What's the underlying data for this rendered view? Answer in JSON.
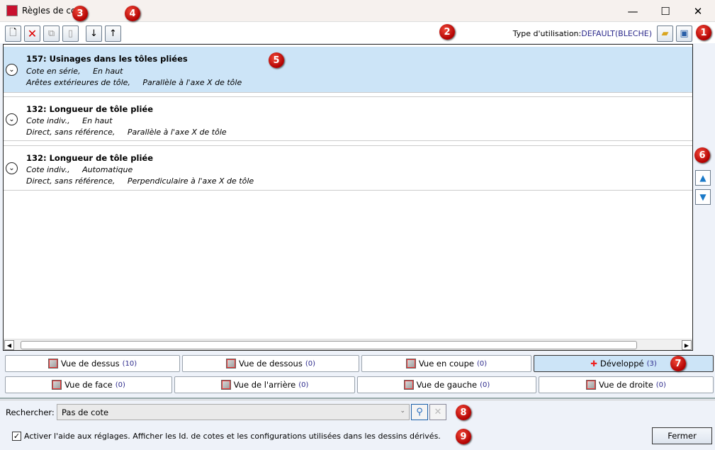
{
  "window": {
    "title": "Règles de cote",
    "minimize": "—",
    "maximize": "☐",
    "close": "✕"
  },
  "toolbar": {
    "type_label": "Type d'utilisation:",
    "type_value": "DEFAULT(BLECHE)"
  },
  "rules": [
    {
      "title": "157: Usinages dans les tôles pliées",
      "line1a": "Cote en série,",
      "line1b": "En haut",
      "line2a": "Arêtes extérieures de tôle,",
      "line2b": "Parallèle à l'axe X de tôle",
      "selected": true
    },
    {
      "title": "132: Longueur de tôle pliée",
      "line1a": "Cote indiv.,",
      "line1b": "En haut",
      "line2a": "Direct, sans référence,",
      "line2b": "Parallèle à l'axe X de tôle",
      "selected": false
    },
    {
      "title": "132: Longueur de tôle pliée",
      "line1a": "Cote indiv.,",
      "line1b": "Automatique",
      "line2a": "Direct, sans référence,",
      "line2b": "Perpendiculaire à l'axe X de tôle",
      "selected": false
    }
  ],
  "views_row1": [
    {
      "label": "Vue de dessus",
      "count": "(10)"
    },
    {
      "label": "Vue de dessous",
      "count": "(0)"
    },
    {
      "label": "Vue en coupe",
      "count": "(0)"
    },
    {
      "label": "Développé",
      "count": "(3)"
    }
  ],
  "views_row2": [
    {
      "label": "Vue de face",
      "count": "(0)"
    },
    {
      "label": "Vue de l'arrière",
      "count": "(0)"
    },
    {
      "label": "Vue de gauche",
      "count": "(0)"
    },
    {
      "label": "Vue de droite",
      "count": "(0)"
    }
  ],
  "search": {
    "label": "Rechercher:",
    "value": "Pas de cote"
  },
  "help_checkbox": {
    "label": "Activer l'aide aux réglages. Afficher les Id. de cotes et les configurations utilisées dans les dessins dérivés.",
    "checked": true
  },
  "close_button": "Fermer",
  "callouts": [
    "1",
    "2",
    "3",
    "4",
    "5",
    "6",
    "7",
    "8",
    "9"
  ]
}
